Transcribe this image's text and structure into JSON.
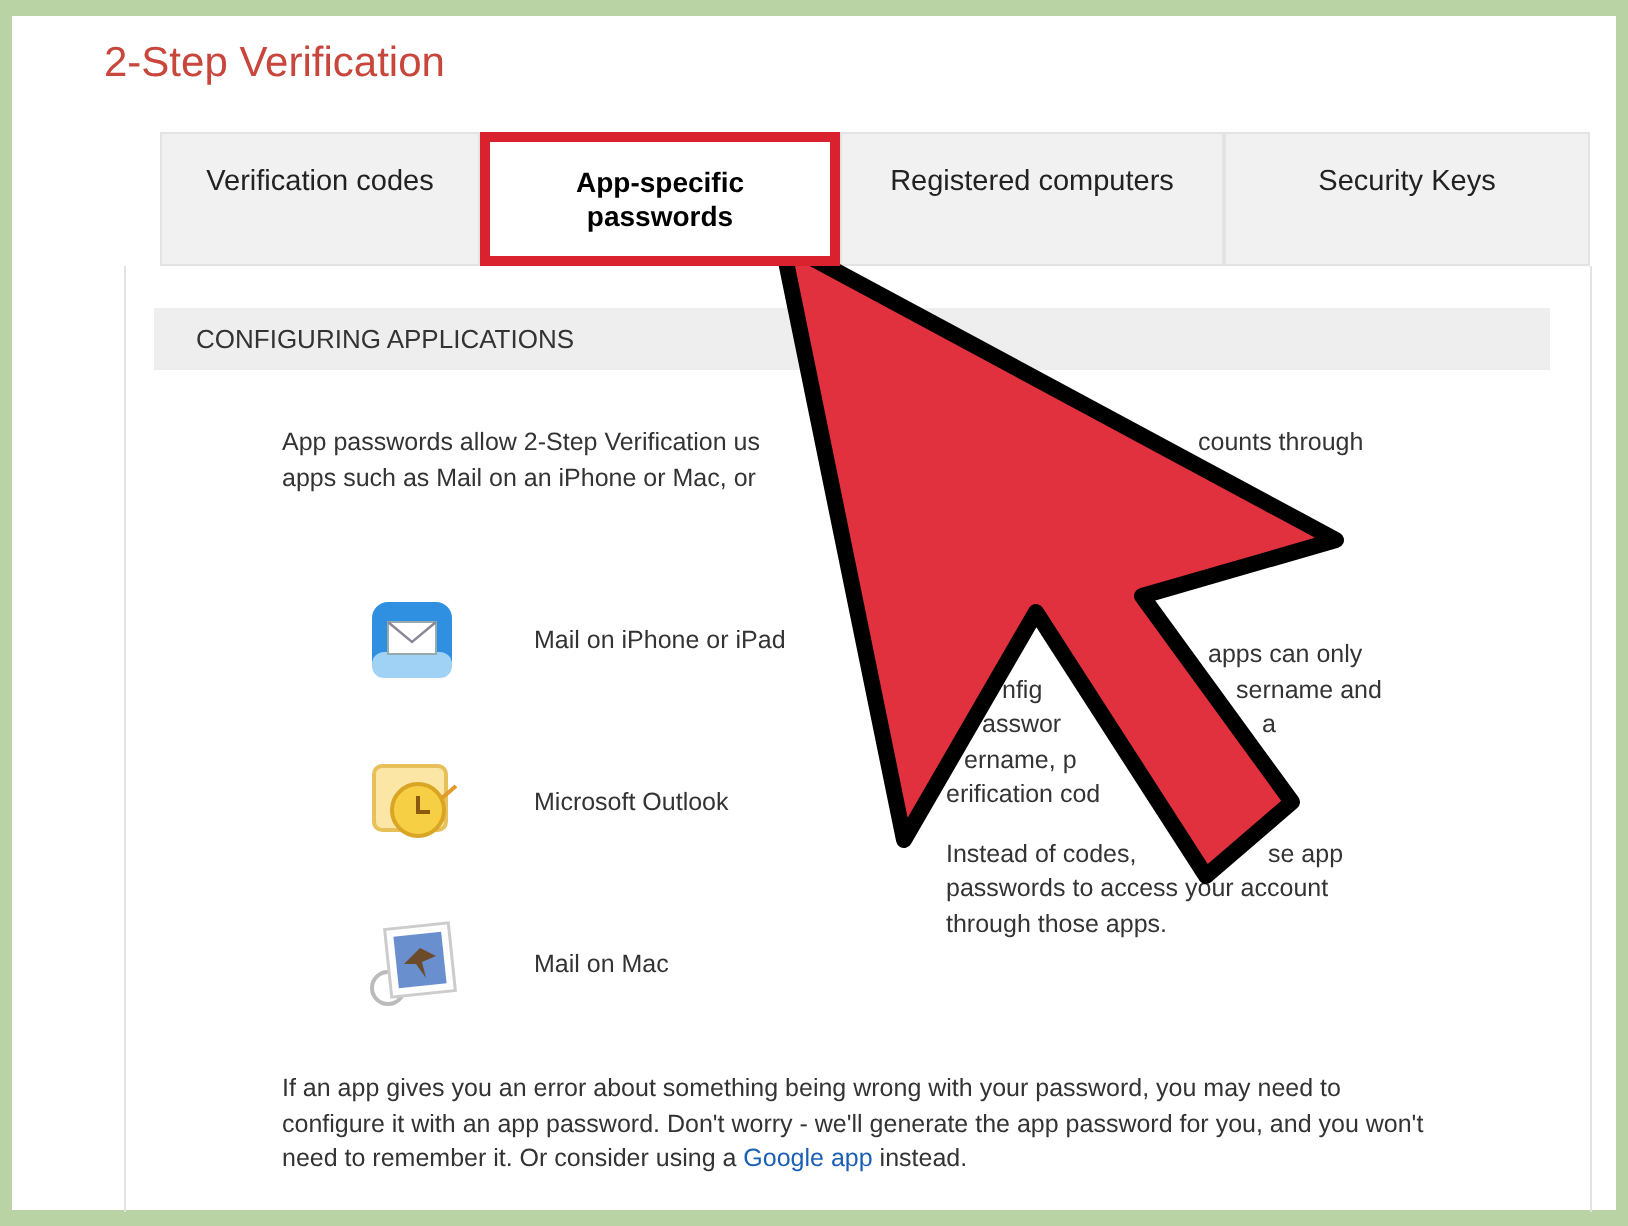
{
  "title": "2-Step Verification",
  "tabs": [
    {
      "label": "Verification codes",
      "selected": false
    },
    {
      "label": "App-specific passwords",
      "selected": true
    },
    {
      "label": "Registered computers",
      "selected": false
    },
    {
      "label": "Security Keys",
      "selected": false
    }
  ],
  "section_header": "CONFIGURING APPLICATIONS",
  "intro_lines": [
    {
      "left": "App passwords allow 2-Step Verification us",
      "right": "counts through"
    },
    {
      "left": "apps such as Mail on an iPhone or Mac, or"
    }
  ],
  "apps": [
    {
      "kind": "iphone-mail",
      "label": "Mail on iPhone or iPad"
    },
    {
      "kind": "outlook",
      "label": "Microsoft Outlook"
    },
    {
      "kind": "mac-mail",
      "label": "Mail on Mac"
    }
  ],
  "side_note_lines": [
    {
      "right": "apps can only"
    },
    {
      "left": "nfig",
      "right": "sername and"
    },
    {
      "left": "asswor",
      "right": "a"
    },
    {
      "left": "ername, p"
    },
    {
      "left": "erification cod"
    }
  ],
  "side_note_tail": [
    {
      "left": "Instead of codes,",
      "right": "se app"
    },
    {
      "left": "passwords to access your account"
    },
    {
      "left": "through those apps."
    }
  ],
  "footer": {
    "text": "If an app gives you an error about something being wrong with your password, you may need to configure it with an app password. Don't worry - we'll generate the app password for you, and you won't need to remember it. Or consider using a",
    "link": "Google app",
    "after": "instead."
  }
}
